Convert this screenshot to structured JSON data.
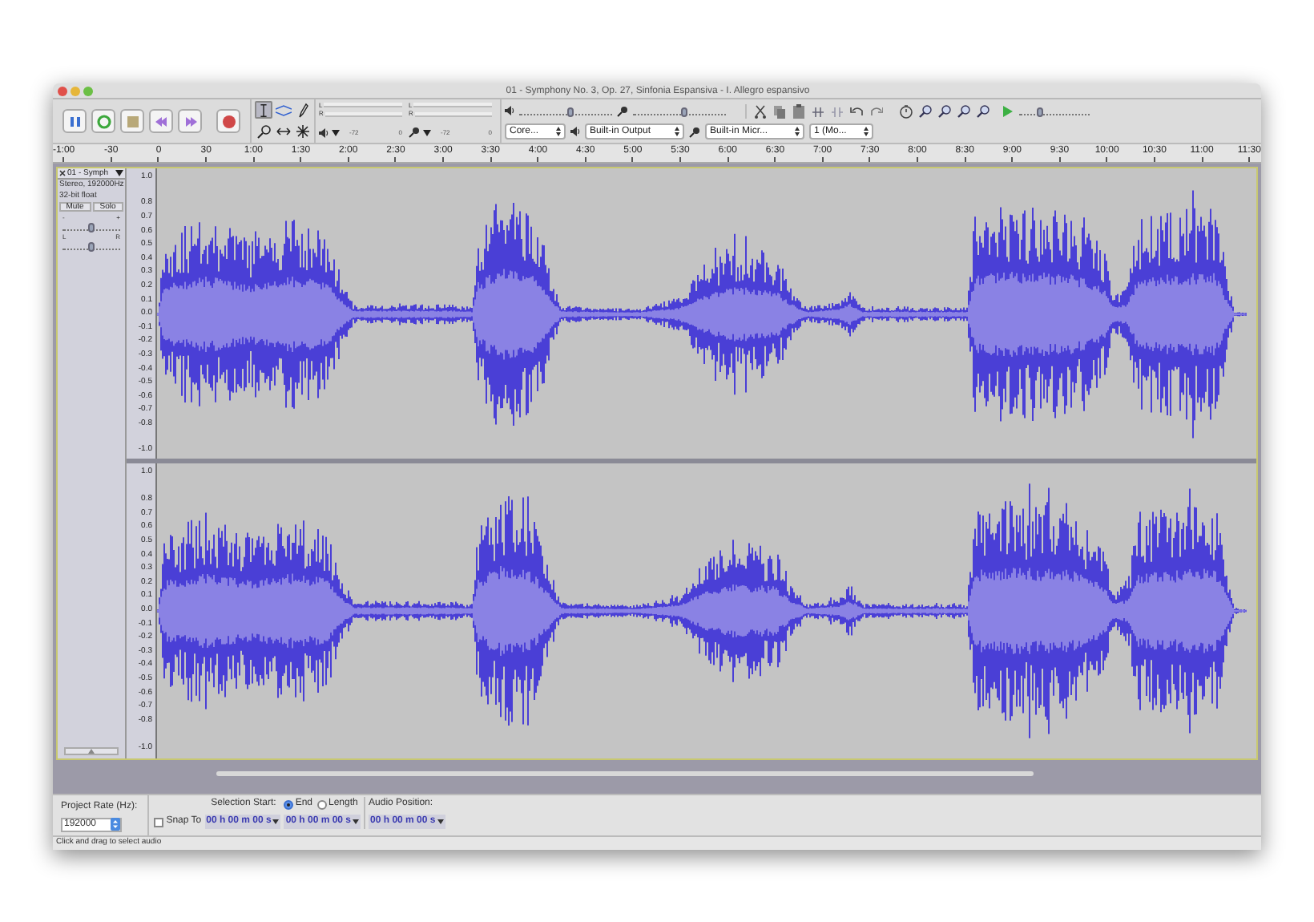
{
  "window": {
    "title": "01 - Symphony No. 3, Op. 27, Sinfonia Espansiva - I. Allegro espansivo"
  },
  "transport": [
    {
      "kind": "pause"
    },
    {
      "kind": "loop"
    },
    {
      "kind": "stop"
    },
    {
      "kind": "skip-start"
    },
    {
      "kind": "skip-end"
    },
    {
      "kind": "record"
    }
  ],
  "tools": [
    {
      "kind": "select",
      "selected": true
    },
    {
      "kind": "envelope",
      "selected": false
    },
    {
      "kind": "draw",
      "selected": false
    },
    {
      "kind": "zoom",
      "selected": false
    },
    {
      "kind": "timeshift",
      "selected": false
    },
    {
      "kind": "multi",
      "selected": false
    }
  ],
  "meters": [
    {
      "kind": "playback",
      "channels": [
        "L",
        "R"
      ],
      "scale": [
        "-72",
        "0"
      ]
    },
    {
      "kind": "recording",
      "channels": [
        "L",
        "R"
      ],
      "scale": [
        "-72",
        "0"
      ]
    }
  ],
  "mixer": [
    {
      "kind": "playback",
      "level": 0.55
    },
    {
      "kind": "recording",
      "level": 0.55
    }
  ],
  "devices": [
    {
      "kind": "host",
      "value": "Core..."
    },
    {
      "kind": "output",
      "value": "Built-in Output"
    },
    {
      "kind": "input",
      "value": "Built-in Micr..."
    },
    {
      "kind": "channels",
      "value": "1 (Mo..."
    }
  ],
  "play_at_speed": {
    "level": 0.3
  },
  "ruler": [
    "-1:00",
    "-30",
    "0",
    "30",
    "1:00",
    "1:30",
    "2:00",
    "2:30",
    "3:00",
    "3:30",
    "4:00",
    "4:30",
    "5:00",
    "5:30",
    "6:00",
    "6:30",
    "7:00",
    "7:30",
    "8:00",
    "8:30",
    "9:00",
    "9:30",
    "10:00",
    "10:30",
    "11:00",
    "11:30"
  ],
  "track": {
    "name": "01 - Symph",
    "info": [
      "Stereo, 192000Hz",
      "32-bit float"
    ],
    "buttons": [
      "Mute",
      "Solo"
    ],
    "gain": {
      "min": "-",
      "max": "+",
      "level": 0.5
    },
    "pan": {
      "min": "L",
      "max": "R",
      "level": 0.5
    },
    "channels": [
      {
        "axis": [
          "1.0",
          "0.8",
          "0.7",
          "0.6",
          "0.5",
          "0.4",
          "0.3",
          "0.2",
          "0.1",
          "0.0",
          "-0.1",
          "-0.2",
          "-0.3",
          "-0.4",
          "-0.5",
          "-0.6",
          "-0.7",
          "-0.8",
          "-1.0"
        ]
      },
      {
        "axis": [
          "1.0",
          "0.8",
          "0.7",
          "0.6",
          "0.5",
          "0.4",
          "0.3",
          "0.2",
          "0.1",
          "0.0",
          "-0.1",
          "-0.2",
          "-0.3",
          "-0.4",
          "-0.5",
          "-0.6",
          "-0.7",
          "-0.8",
          "-1.0"
        ]
      }
    ]
  },
  "selection_bar": {
    "project_rate": {
      "label": "Project Rate (Hz):",
      "value": "192000"
    },
    "snap_to": {
      "label": "Snap To",
      "checked": false
    },
    "selection_start": {
      "label": "Selection Start:",
      "value": "00 h 00 m 00 s"
    },
    "end_mode": [
      {
        "label": "End",
        "selected": true
      },
      {
        "label": "Length",
        "selected": false
      }
    ],
    "end_value": "00 h 00 m 00 s",
    "audio_position": {
      "label": "Audio Position:",
      "value": "00 h 00 m 00 s"
    }
  },
  "status_bar": "Click and drag to select audio"
}
